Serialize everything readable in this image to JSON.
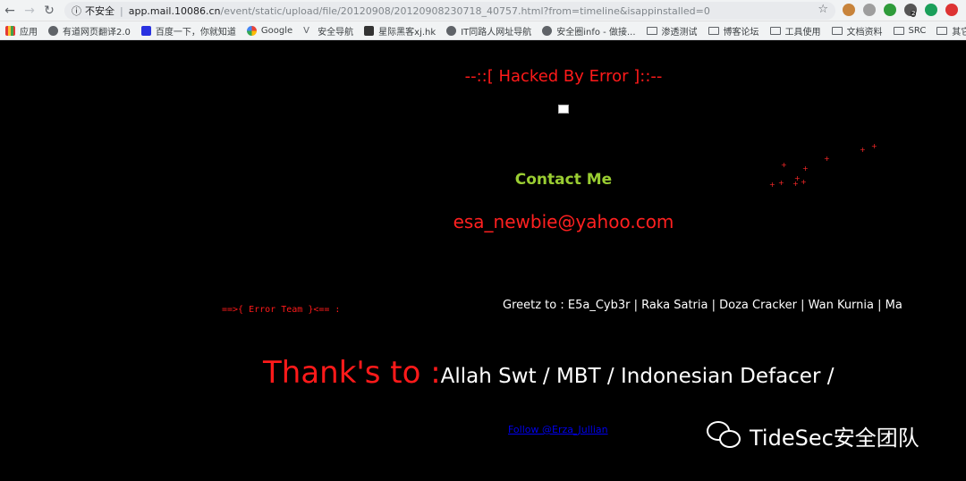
{
  "browser": {
    "address": {
      "security_label": "不安全",
      "host": "app.mail.10086.cn",
      "path": "/event/static/upload/file/20120908/20120908230718_40757.html?from=timeline&isappinstalled=0"
    },
    "bookmarks": [
      {
        "label": "应用",
        "icon": "apps-grid-icon"
      },
      {
        "label": "有道网页翻译2.0",
        "icon": "globe-icon"
      },
      {
        "label": "百度一下，你就知道",
        "icon": "baidu-icon"
      },
      {
        "label": "Google",
        "icon": "google-icon"
      },
      {
        "label": "安全导航",
        "icon": "v-icon"
      },
      {
        "label": "星际黑客xj.hk",
        "icon": "bookmark-icon"
      },
      {
        "label": "IT同路人网址导航",
        "icon": "globe-icon"
      },
      {
        "label": "安全圈info - 做接...",
        "icon": "globe-icon"
      },
      {
        "label": "渗透测试",
        "icon": "folder-icon"
      },
      {
        "label": "博客论坛",
        "icon": "folder-icon"
      },
      {
        "label": "工具使用",
        "icon": "folder-icon"
      },
      {
        "label": "文档资料",
        "icon": "folder-icon"
      },
      {
        "label": "SRC",
        "icon": "folder-icon"
      },
      {
        "label": "其它网站",
        "icon": "folder-icon"
      }
    ],
    "ext_badge": "2"
  },
  "page": {
    "hacked_title": "--::[ Hacked By Error ]::--",
    "contact_label": "Contact Me",
    "email": "esa_newbie@yahoo.com",
    "team": "==>{ Error Team }<== :",
    "greetz": "Greetz to : E5a_Cyb3r | Raka Satria | Doza Cracker | Wan Kurnia | Ma",
    "thanks_prefix": "Thank's to :",
    "thanks_list": "Allah Swt / MBT / Indonesian Defacer /",
    "follow_link": "Follow @Erza_Jullian"
  },
  "watermark": {
    "text": "TideSec安全团队"
  },
  "colors": {
    "red": "#ff1a1a",
    "green": "#9acd32",
    "link": "#0000ee"
  }
}
